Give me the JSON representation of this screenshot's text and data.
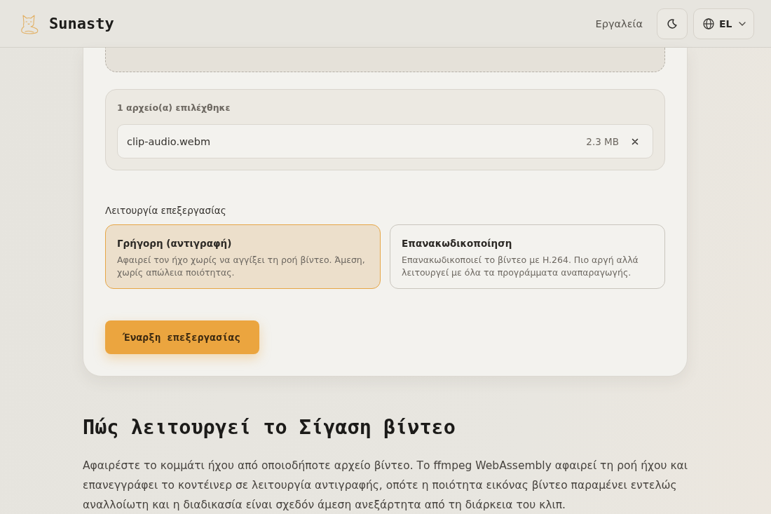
{
  "header": {
    "brand": "Sunasty",
    "nav_link": "Εργαλεία",
    "language": "EL"
  },
  "upload": {
    "selected_count": "1 αρχείο(α) επιλέχθηκε",
    "files": [
      {
        "name": "clip-audio.webm",
        "size": "2.3 MB"
      }
    ]
  },
  "processing": {
    "label": "Λειτουργία επεξεργασίας",
    "modes": [
      {
        "title": "Γρήγορη (αντιγραφή)",
        "description": "Αφαιρεί τον ήχο χωρίς να αγγίξει τη ροή βίντεο. Άμεση, χωρίς απώλεια ποιότητας.",
        "selected": true
      },
      {
        "title": "Επανακωδικοποίηση",
        "description": "Επανακωδικοποιεί το βίντεο με H.264. Πιο αργή αλλά λειτουργεί με όλα τα προγράμματα αναπαραγωγής.",
        "selected": false
      }
    ],
    "start_button": "Έναρξη επεξεργασίας"
  },
  "how_it_works": {
    "heading": "Πώς λειτουργεί το Σίγαση βίντεο",
    "paragraph": "Αφαιρέστε το κομμάτι ήχου από οποιοδήποτε αρχείο βίντεο. Το ffmpeg WebAssembly αφαιρεί τη ροή ήχου και επανεγγράφει το κοντέινερ σε λειτουργία αντιγραφής, οπότε η ποιότητα εικόνας βίντεο παραμένει εντελώς αναλλοίωτη και η διαδικασία είναι σχεδόν άμεση ανεξάρτητα από τη διάρκεια του κλιπ."
  }
}
